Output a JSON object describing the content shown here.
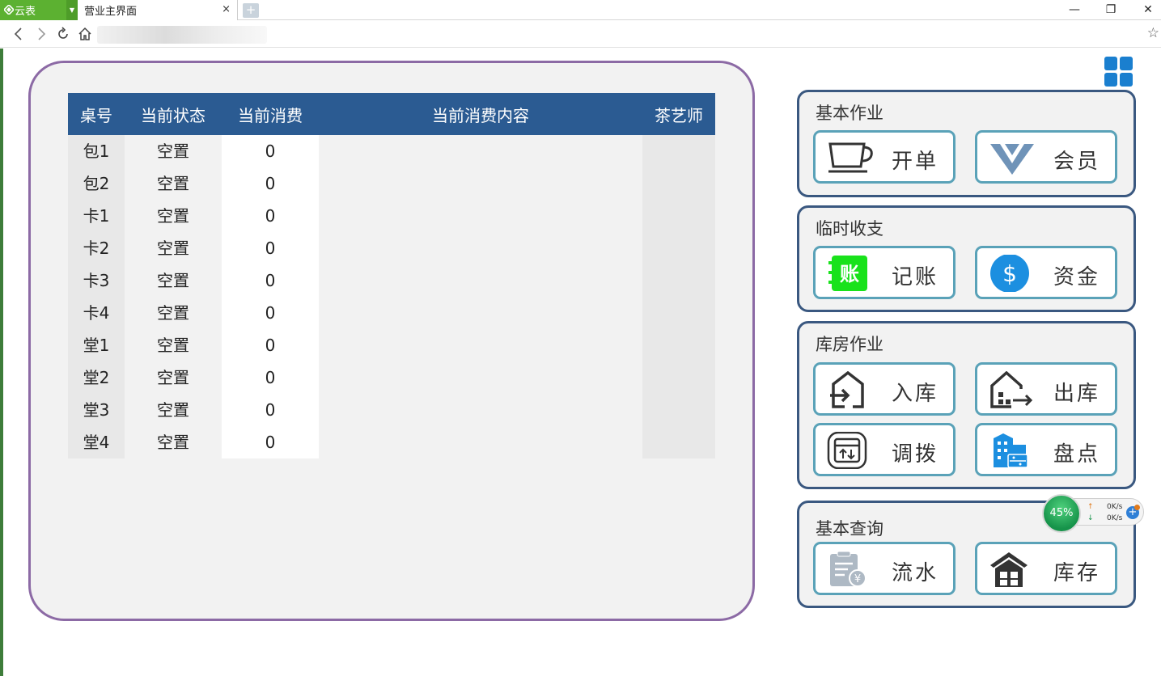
{
  "browser": {
    "app_tab_label": "云表",
    "page_tab_title": "营业主界面",
    "tab_close": "×",
    "new_tab": "+",
    "window_controls": {
      "minimize": "—",
      "restore": "❐",
      "close": "✕"
    },
    "bookmark_icon": "☆"
  },
  "table": {
    "headers": [
      "桌号",
      "当前状态",
      "当前消费",
      "当前消费内容",
      "茶艺师"
    ],
    "rows": [
      {
        "table_no": "包1",
        "status": "空置",
        "amount": "0",
        "content": "",
        "tea_master": ""
      },
      {
        "table_no": "包2",
        "status": "空置",
        "amount": "0",
        "content": "",
        "tea_master": ""
      },
      {
        "table_no": "卡1",
        "status": "空置",
        "amount": "0",
        "content": "",
        "tea_master": ""
      },
      {
        "table_no": "卡2",
        "status": "空置",
        "amount": "0",
        "content": "",
        "tea_master": ""
      },
      {
        "table_no": "卡3",
        "status": "空置",
        "amount": "0",
        "content": "",
        "tea_master": ""
      },
      {
        "table_no": "卡4",
        "status": "空置",
        "amount": "0",
        "content": "",
        "tea_master": ""
      },
      {
        "table_no": "堂1",
        "status": "空置",
        "amount": "0",
        "content": "",
        "tea_master": ""
      },
      {
        "table_no": "堂2",
        "status": "空置",
        "amount": "0",
        "content": "",
        "tea_master": ""
      },
      {
        "table_no": "堂3",
        "status": "空置",
        "amount": "0",
        "content": "",
        "tea_master": ""
      },
      {
        "table_no": "堂4",
        "status": "空置",
        "amount": "0",
        "content": "",
        "tea_master": ""
      }
    ]
  },
  "groups": {
    "basic": {
      "title": "基本作业",
      "open_order": "开单",
      "member": "会员"
    },
    "temp": {
      "title": "临时收支",
      "bookkeeping": "记账",
      "funds": "资金"
    },
    "warehouse": {
      "title": "库房作业",
      "stock_in": "入库",
      "stock_out": "出库",
      "transfer": "调拨",
      "inventory": "盘点"
    },
    "query": {
      "title": "基本查询",
      "flow": "流水",
      "stock": "库存"
    }
  },
  "icons": {
    "bookkeeping_glyph": "账",
    "funds_glyph": "$",
    "flow_glyph": "¥"
  },
  "speed_widget": {
    "percent": "45%",
    "upload": "0K/s",
    "download": "0K/s",
    "up_arrow": "↑",
    "down_arrow": "↓",
    "plus": "+"
  },
  "colors": {
    "table_header": "#2b5b92",
    "panel_border": "#8c6aa5",
    "group_border": "#3a5880",
    "button_border": "#5aa2b8",
    "tab_green": "#5cb131"
  }
}
